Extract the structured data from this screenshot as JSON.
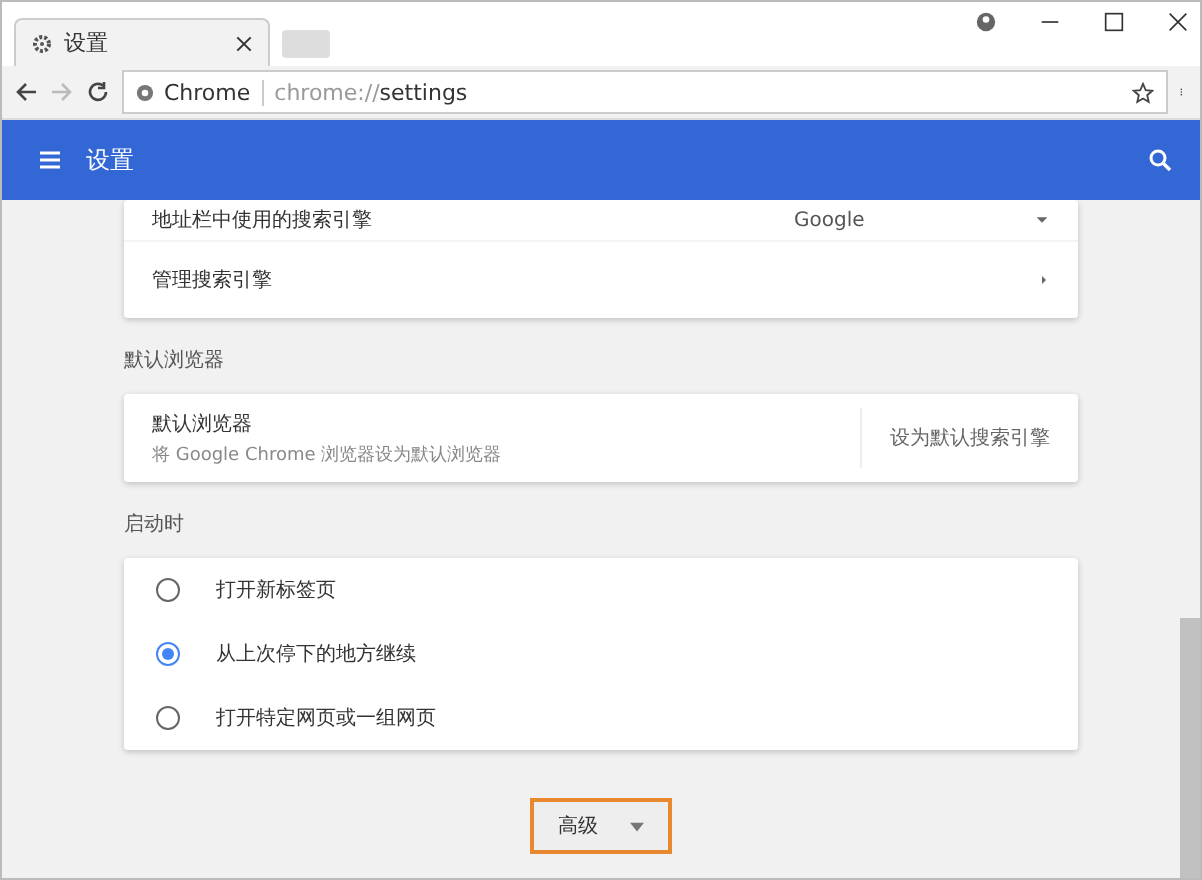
{
  "tab": {
    "title": "设置"
  },
  "address_bar": {
    "site": "Chrome",
    "url_scheme": "chrome://",
    "url_path": "settings"
  },
  "header": {
    "title": "设置"
  },
  "search_engine_card": {
    "rows": [
      {
        "kind": "dropdown",
        "label": "地址栏中使用的搜索引擎",
        "value": "Google"
      },
      {
        "kind": "link",
        "label": "管理搜索引擎"
      }
    ]
  },
  "default_browser": {
    "section_title": "默认浏览器",
    "title": "默认浏览器",
    "subtitle": "将 Google Chrome 浏览器设为默认浏览器",
    "button": "设为默认搜索引擎"
  },
  "startup": {
    "section_title": "启动时",
    "options": [
      {
        "label": "打开新标签页",
        "selected": false
      },
      {
        "label": "从上次停下的地方继续",
        "selected": true
      },
      {
        "label": "打开特定网页或一组网页",
        "selected": false
      }
    ]
  },
  "advanced_button": {
    "label": "高级"
  }
}
